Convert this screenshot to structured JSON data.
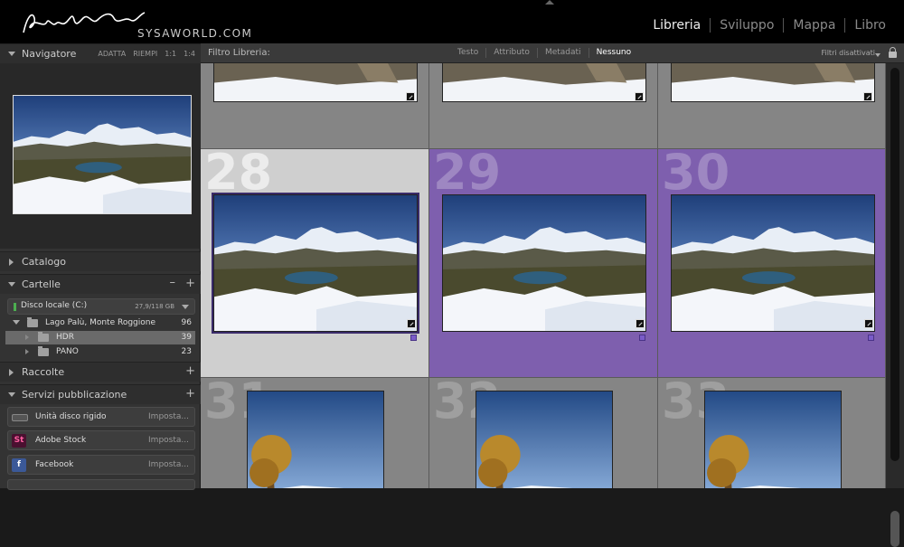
{
  "app": {
    "brand": "SYSAWORLD.COM"
  },
  "modules": [
    "Libreria",
    "Sviluppo",
    "Mappa",
    "Libro"
  ],
  "active_module": "Libreria",
  "navigator": {
    "title": "Navigatore",
    "zoom_options": [
      "ADATTA",
      "RIEMPI",
      "1:1",
      "1:4"
    ]
  },
  "panels": {
    "catalog": "Catalogo",
    "folders": "Cartelle",
    "collections": "Raccolte",
    "publish": "Servizi pubblicazione"
  },
  "volume": {
    "name": "Disco locale (C:)",
    "size": "27,9/118 GB"
  },
  "folders": [
    {
      "name": "Lago Palù, Monte Roggione",
      "count": "96"
    },
    {
      "name": "HDR",
      "count": "39"
    },
    {
      "name": "PANO",
      "count": "23"
    }
  ],
  "publish_services": [
    {
      "name": "Unità disco rigido",
      "action": "Imposta..."
    },
    {
      "name": "Adobe Stock",
      "action": "Imposta...",
      "icon_text": "St"
    },
    {
      "name": "Facebook",
      "action": "Imposta...",
      "icon_text": "f"
    }
  ],
  "filter_bar": {
    "label": "Filtro Libreria:",
    "tabs": [
      "Testo",
      "Attributo",
      "Metadati",
      "Nessuno"
    ],
    "active_tab": "Nessuno",
    "state": "Filtri disattivati"
  },
  "grid_numbers": [
    "28",
    "29",
    "30",
    "31",
    "32",
    "33"
  ],
  "colors": {
    "accent_purple": "#7e5fae",
    "selected_cell": "#cfcfcf",
    "cell_bg": "#858585"
  }
}
